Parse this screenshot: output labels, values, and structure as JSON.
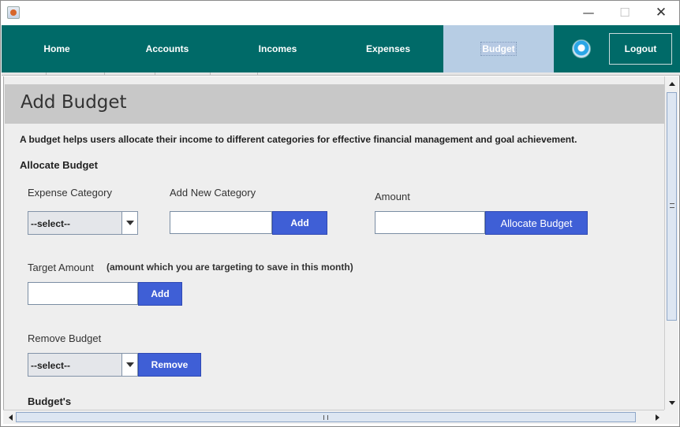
{
  "window": {
    "controls": {
      "minimize": "—",
      "maximize": "☐",
      "close": "✕"
    }
  },
  "nav": {
    "items": [
      {
        "label": "Home"
      },
      {
        "label": "Accounts"
      },
      {
        "label": "Incomes"
      },
      {
        "label": "Expenses"
      },
      {
        "label": "Budget",
        "active": true
      }
    ],
    "logout_label": "Logout",
    "colors": {
      "bar": "#006a68",
      "active": "#b7cde4"
    }
  },
  "page": {
    "title": "Add Budget",
    "description": "A budget helps users allocate their income to different categories for effective financial management and goal achievement.",
    "allocate_heading": "Allocate Budget",
    "expense_category_label": "Expense Category",
    "expense_category_value": "--select--",
    "add_new_category_label": "Add New Category",
    "add_category_button": "Add",
    "amount_label": "Amount",
    "allocate_button": "Allocate Budget",
    "target_amount_label": "Target Amount",
    "target_amount_note": "(amount which you are targeting to save in this month)",
    "target_add_button": "Add",
    "remove_budget_label": "Remove Budget",
    "remove_select_value": "--select--",
    "remove_button": "Remove",
    "budgets_heading": "Budget's",
    "button_color": "#3f5fd6"
  }
}
